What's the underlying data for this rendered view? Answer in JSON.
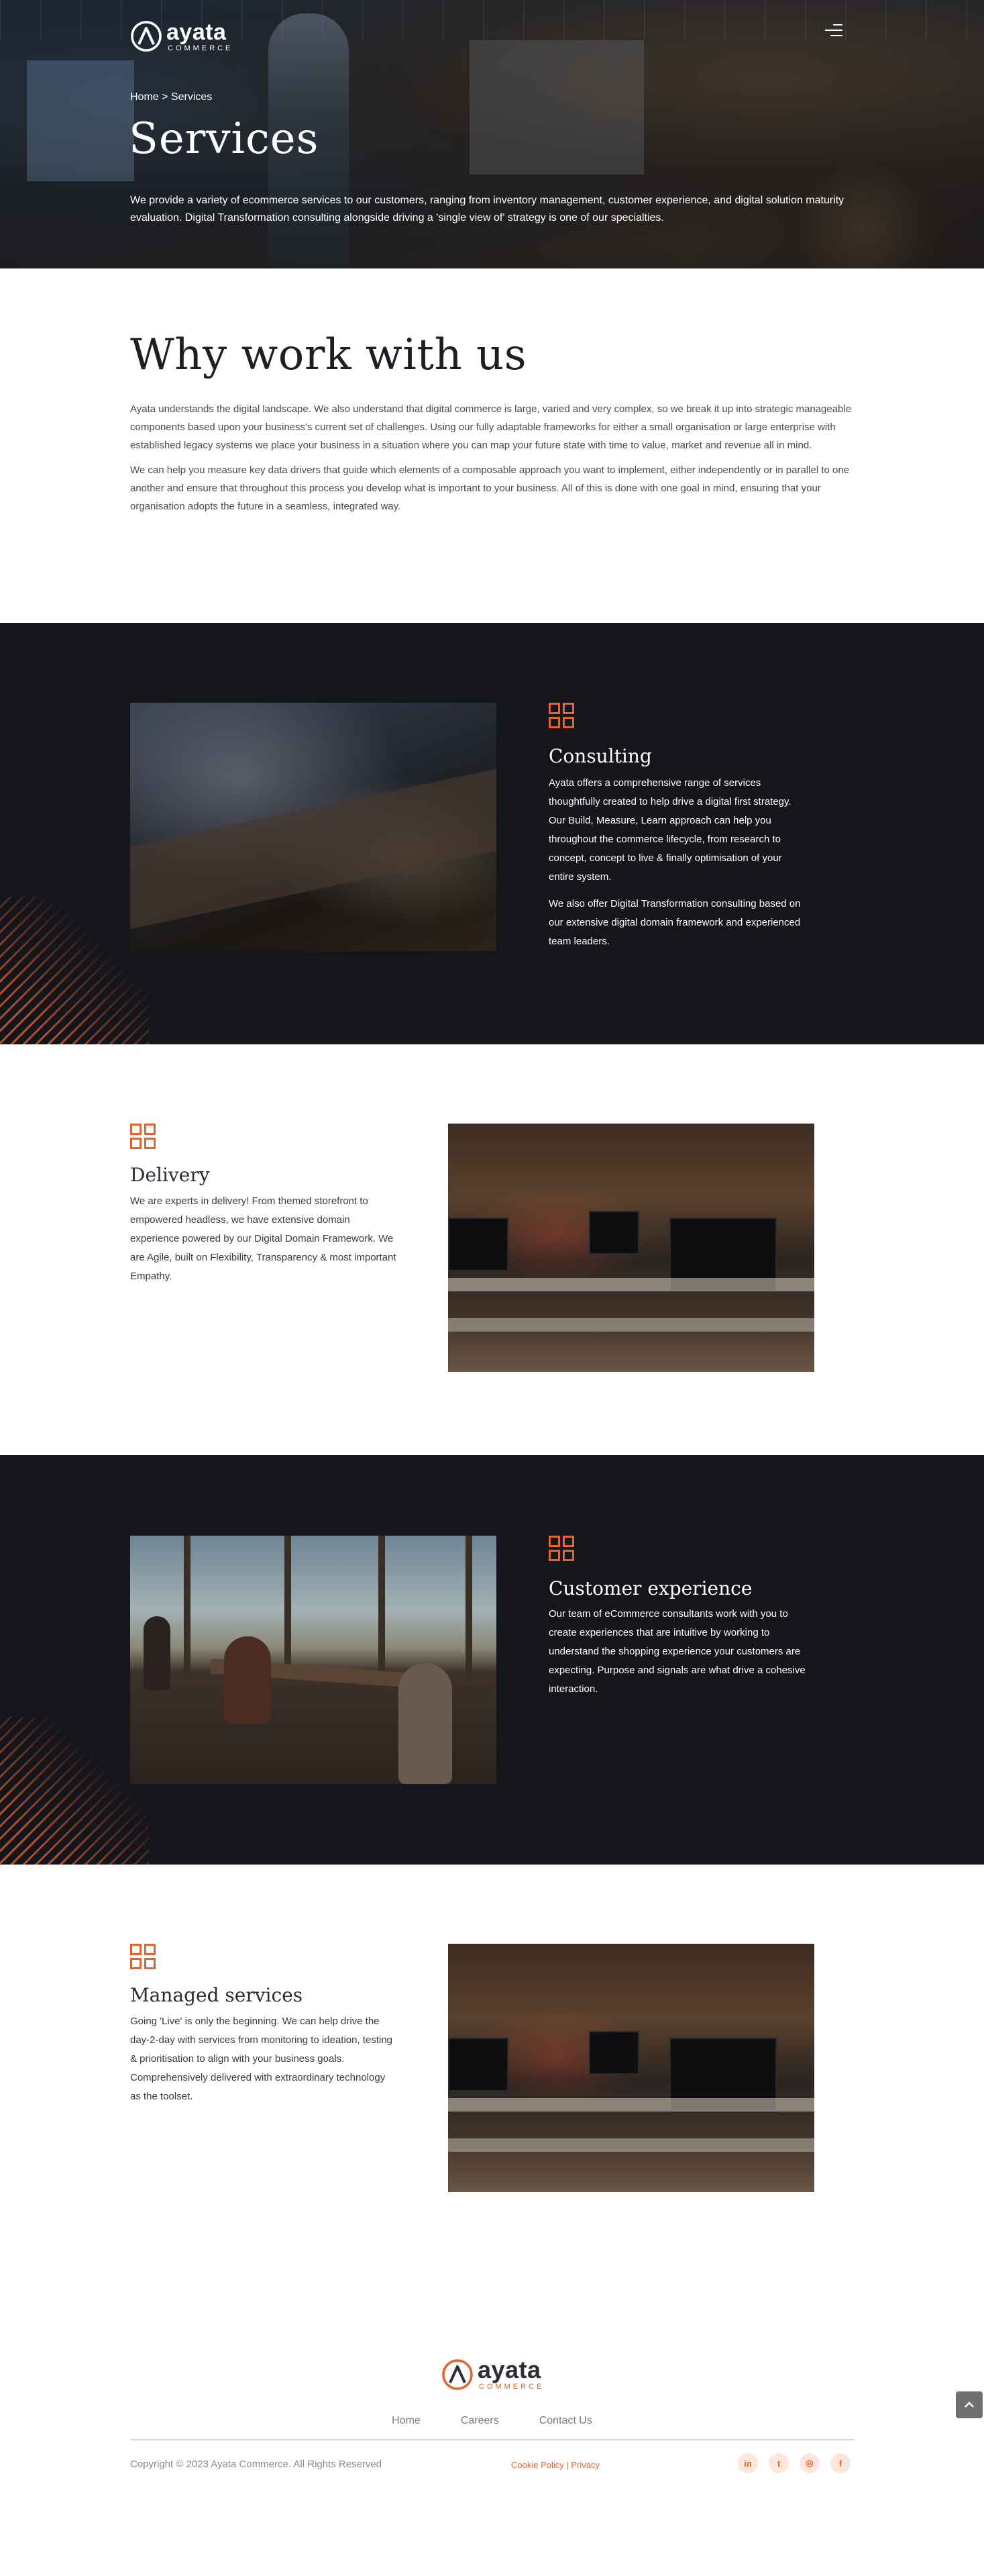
{
  "brand": {
    "name": "ayata",
    "tagline": "COMMERCE",
    "accent": "#e0652f",
    "dark_bg": "#15151c"
  },
  "header": {
    "breadcrumb": "Home > Services",
    "title": "Services",
    "description": "We provide a variety of ecommerce services to our customers, ranging from inventory management, customer experience, and digital solution maturity evaluation. Digital Transformation consulting alongside driving a 'single view of' strategy is one of our specialties.",
    "menu_icon": "hamburger-menu-icon"
  },
  "why": {
    "title": "Why work with us",
    "paragraphs": [
      "Ayata understands the digital landscape. We also understand that digital commerce is large, varied and very complex, so we break it up into strategic manageable components based upon your business's current set of challenges. Using our fully adaptable frameworks for either a small organisation or large enterprise with established legacy systems we place your business in a situation where you can map your future state with time to value, market and revenue all in mind.",
      "We can help you measure key data drivers that guide which elements of a composable approach you want to implement, either independently or in parallel to one another and ensure that throughout this process you develop what is important to your business. All of this is done with one goal in mind, ensuring that your organisation adopts the future in a seamless, integrated way."
    ]
  },
  "services": [
    {
      "title": "Consulting",
      "paragraphs": [
        "Ayata offers a comprehensive range of services thoughtfully created to help drive a digital first strategy.  Our Build, Measure, Learn approach can help you throughout the commerce lifecycle, from research to concept, concept to live & finally optimisation of your entire system.",
        "We also offer Digital Transformation consulting based on our extensive digital domain framework and experienced team leaders."
      ],
      "icon": "grid-icon"
    },
    {
      "title": "Delivery",
      "paragraphs": [
        "We are experts in delivery! From themed storefront to empowered headless, we have extensive domain experience powered by our Digital Domain Framework.  We are Agile, built on Flexibility, Transparency &  most important Empathy."
      ],
      "icon": "grid-icon"
    },
    {
      "title": "Customer experience",
      "paragraphs": [
        "Our team of eCommerce consultants work with you to create experiences that are intuitive by working to understand the shopping experience your customers are expecting. Purpose and signals are what drive a cohesive interaction."
      ],
      "icon": "grid-icon"
    },
    {
      "title": "Managed services",
      "paragraphs": [
        "Going 'Live' is only the beginning.  We can help drive the day-2-day with services from monitoring to ideation, testing & prioritisation to align with your business goals. Comprehensively delivered with extraordinary technology as the toolset."
      ],
      "icon": "grid-icon"
    }
  ],
  "footer": {
    "nav": [
      "Home",
      "Careers",
      "Contact Us"
    ],
    "copyright": "Copyright © 2023 Ayata Commerce. All Rights Reserved",
    "cookie_policy": "Cookie Policy",
    "separator": "|",
    "privacy": "Privacy",
    "social": [
      {
        "icon": "linkedin-icon",
        "glyph": "in"
      },
      {
        "icon": "twitter-icon",
        "glyph": "t"
      },
      {
        "icon": "instagram-icon",
        "glyph": "◎"
      },
      {
        "icon": "facebook-icon",
        "glyph": "f"
      }
    ],
    "scroll_top_icon": "chevron-up-icon"
  }
}
